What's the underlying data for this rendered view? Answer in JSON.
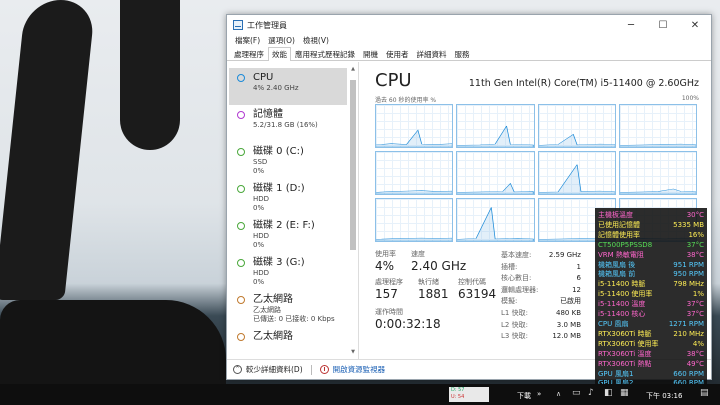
{
  "window": {
    "title": "工作管理員",
    "min": "─",
    "max": "☐",
    "close": "✕"
  },
  "menu": [
    "檔案(F)",
    "選項(O)",
    "檢視(V)"
  ],
  "tabs": [
    "處理程序",
    "效能",
    "應用程式歷程記錄",
    "開機",
    "使用者",
    "詳細資料",
    "服務"
  ],
  "resources": [
    {
      "name": "CPU",
      "sub1": "4% 2.40 GHz",
      "sub2": "",
      "color": "#1b8ad8"
    },
    {
      "name": "記憶體",
      "sub1": "5.2/31.8 GB (16%)",
      "sub2": "",
      "color": "#b13ad1"
    },
    {
      "name": "磁碟 0 (C:)",
      "sub1": "SSD",
      "sub2": "0%",
      "color": "#4aa83b"
    },
    {
      "name": "磁碟 1 (D:)",
      "sub1": "HDD",
      "sub2": "0%",
      "color": "#4aa83b"
    },
    {
      "name": "磁碟 2 (E: F:)",
      "sub1": "HDD",
      "sub2": "0%",
      "color": "#4aa83b"
    },
    {
      "name": "磁碟 3 (G:)",
      "sub1": "HDD",
      "sub2": "0%",
      "color": "#4aa83b"
    },
    {
      "name": "乙太網路",
      "sub1": "乙太網路",
      "sub2": "已傳送: 0 已接收: 0 Kbps",
      "color": "#c07a2f"
    },
    {
      "name": "乙太網路",
      "sub1": "",
      "sub2": "",
      "color": "#c07a2f"
    }
  ],
  "cpu": {
    "title": "CPU",
    "model": "11th Gen Intel(R) Core(TM) i5-11400 @ 2.60GHz",
    "graph_label": "過去 60 秒的使用率 %",
    "graph_max": "100%"
  },
  "stats": {
    "usage_label": "使用率",
    "usage": "4%",
    "speed_label": "速度",
    "speed": "2.40 GHz",
    "proc_label": "處理程序",
    "proc": "157",
    "threads_label": "執行緒",
    "threads": "1881",
    "handles_label": "控制代碼",
    "handles": "63194",
    "uptime_label": "運作時間",
    "uptime": "0:00:32:18"
  },
  "details": [
    {
      "k": "基本速度:",
      "v": "2.59 GHz"
    },
    {
      "k": "插槽:",
      "v": "1"
    },
    {
      "k": "核心數目:",
      "v": "6"
    },
    {
      "k": "邏輯處理器:",
      "v": "12"
    },
    {
      "k": "模擬:",
      "v": "已啟用"
    },
    {
      "k": "L1 快取:",
      "v": "480 KB"
    },
    {
      "k": "L2 快取:",
      "v": "3.0 MB"
    },
    {
      "k": "L3 快取:",
      "v": "12.0 MB"
    }
  ],
  "footer": {
    "less": "較少詳細資料(D)",
    "monitor": "開啟資源監視器"
  },
  "overlay": [
    {
      "k": "主機板溫度",
      "v": "30°C",
      "c": "#ff66cc"
    },
    {
      "k": "已使用記憶體",
      "v": "5335 MB",
      "c": "#ffee55"
    },
    {
      "k": "記憶體使用率",
      "v": "16%",
      "c": "#ffee55"
    },
    {
      "k": "CT500P5PSSD8",
      "v": "37°C",
      "c": "#55dd55"
    },
    {
      "k": "VRM 熱敏電阻",
      "v": "38°C",
      "c": "#ff66cc"
    },
    {
      "k": "機箱風扇 後",
      "v": "951 RPM",
      "c": "#55ccff"
    },
    {
      "k": "機箱風扇 前",
      "v": "950 RPM",
      "c": "#55ccff"
    },
    {
      "k": "i5-11400 時脈",
      "v": "798 MHz",
      "c": "#ffee55"
    },
    {
      "k": "i5-11400 使用率",
      "v": "1%",
      "c": "#ffee55"
    },
    {
      "k": "i5-11400 溫度",
      "v": "37°C",
      "c": "#ff66cc"
    },
    {
      "k": "i5-11400 核心",
      "v": "37°C",
      "c": "#ff66cc"
    },
    {
      "k": "CPU 風扇",
      "v": "1271 RPM",
      "c": "#55ccff"
    },
    {
      "k": "RTX3060Ti 時脈",
      "v": "210 MHz",
      "c": "#ffee55"
    },
    {
      "k": "RTX3060Ti 使用率",
      "v": "4%",
      "c": "#ffee55"
    },
    {
      "k": "RTX3060Ti 溫度",
      "v": "38°C",
      "c": "#ff66cc"
    },
    {
      "k": "RTX3060Ti 熱點",
      "v": "49°C",
      "c": "#ff66cc"
    },
    {
      "k": "GPU 風扇1",
      "v": "660 RPM",
      "c": "#55ccff"
    },
    {
      "k": "GPU 風扇2",
      "v": "660 RPM",
      "c": "#55ccff"
    }
  ],
  "taskbar": {
    "widget_d": "D: 57",
    "widget_u": "U: 54",
    "dl": "下載",
    "chev": "»",
    "arrow": "∧",
    "time": "下午 03:16"
  }
}
